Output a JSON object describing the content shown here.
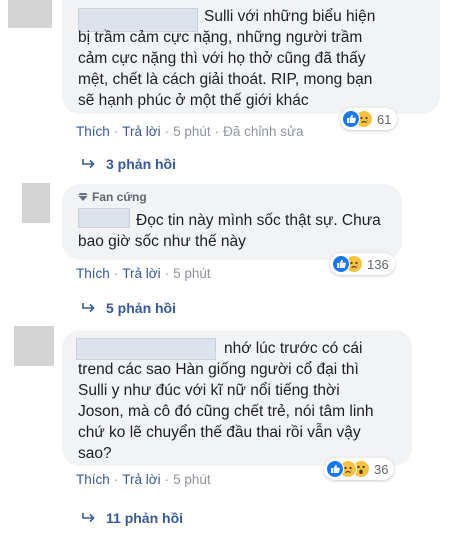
{
  "comments": [
    {
      "lines": [
        "Sulli với những biểu hiện",
        "bị trầm cảm cực nặng, những người trầm",
        "cảm cực nặng thì với họ thở cũng đã thấy",
        "mệt, chết là cách giải thoát. RIP, mong bạn",
        "sẽ hạnh phúc ở một thế giới khác"
      ],
      "like": "Thích",
      "reply": "Trả lời",
      "time": "5 phút",
      "edited": "Đã chỉnh sửa",
      "reaction_count": "61",
      "replies": "3 phản hồi"
    },
    {
      "badge": "Fan cứng",
      "lines": [
        "Đọc tin này mình sốc thật sự. Chưa",
        "bao giờ sốc như thế này"
      ],
      "like": "Thích",
      "reply": "Trả lời",
      "time": "5 phút",
      "reaction_count": "136",
      "replies": "5 phản hồi"
    },
    {
      "lines": [
        "nhớ lúc trước có cái",
        "trend các sao Hàn giống người cổ đại thì",
        "Sulli y như đúc với kĩ nữ nổi tiếng thời",
        "Joson, mà cô đó cũng chết trẻ, nói tâm linh",
        "chứ ko lẽ chuyển thế đầu thai rồi vẫn vậy",
        "sao?"
      ],
      "like": "Thích",
      "reply": "Trả lời",
      "time": "5 phút",
      "reaction_count": "36",
      "replies": "11 phản hồi"
    }
  ],
  "icons": [
    "like-reaction-icon",
    "sad-reaction-icon",
    "wow-reaction-icon",
    "diamond-icon",
    "reply-arrow-icon"
  ],
  "colors": {
    "link": "#385898",
    "bubble": "#f2f3f5",
    "muted": "#90949c",
    "like": "#1877f2",
    "emoji": "#f7c244"
  }
}
